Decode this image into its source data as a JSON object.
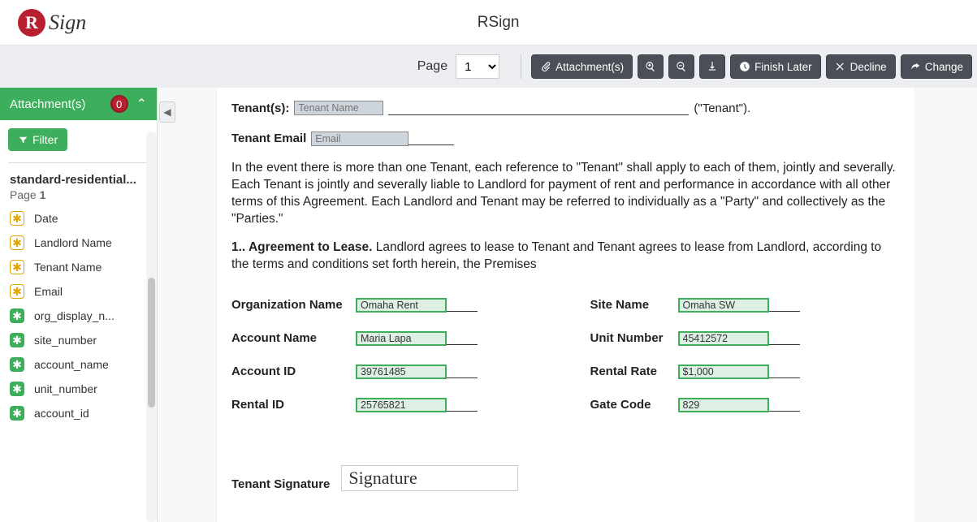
{
  "app": {
    "brand_letter": "R",
    "brand_word": "Sign",
    "title": "RSign"
  },
  "toolbar": {
    "page_label": "Page",
    "page_value": "1",
    "attachments": "Attachment(s)",
    "finish_later": "Finish Later",
    "decline": "Decline",
    "change": "Change"
  },
  "sidebar": {
    "header": "Attachment(s)",
    "badge": "0",
    "filter": "Filter",
    "document": "standard-residential...",
    "page_label": "Page",
    "page_num": "1",
    "fields": [
      {
        "icon": "req",
        "label": "Date"
      },
      {
        "icon": "req",
        "label": "Landlord Name"
      },
      {
        "icon": "req",
        "label": "Tenant Name"
      },
      {
        "icon": "req",
        "label": "Email"
      },
      {
        "icon": "merge",
        "label": "org_display_n..."
      },
      {
        "icon": "merge",
        "label": "site_number"
      },
      {
        "icon": "merge",
        "label": "account_name"
      },
      {
        "icon": "merge",
        "label": "unit_number"
      },
      {
        "icon": "merge",
        "label": "account_id"
      }
    ]
  },
  "doc": {
    "tenant_label": "Tenant(s):",
    "tenant_placeholder": "Tenant Name",
    "tenant_suffix": "(\"Tenant\").",
    "tenant_email_label": "Tenant Email",
    "tenant_email_placeholder": "Email",
    "para1": "In the event there is more than one Tenant, each reference to \"Tenant\" shall apply to each of them, jointly and severally. Each Tenant is jointly and severally liable to Landlord for payment of rent and performance in accordance with all other terms of this Agreement. Each Landlord and Tenant may be referred to individually as a \"Party\" and collectively as the \"Parties.\"",
    "para2_lead": "1.. Agreement to Lease.",
    "para2_rest": " Landlord agrees to lease to Tenant and Tenant agrees to lease from Landlord, according to the terms and conditions set forth herein, the Premises",
    "merge": {
      "org_label": "Organization Name",
      "org_value": "Omaha Rent",
      "site_label": "Site Name",
      "site_value": "Omaha SW",
      "acct_name_label": "Account Name",
      "acct_name_value": "Maria Lapa",
      "unit_label": "Unit Number",
      "unit_value": "45412572",
      "acct_id_label": "Account ID",
      "acct_id_value": "39761485",
      "rate_label": "Rental Rate",
      "rate_value": "$1,000",
      "rental_id_label": "Rental ID",
      "rental_id_value": "25765821",
      "gate_label": "Gate Code",
      "gate_value": "829"
    },
    "sig_label": "Tenant Signature",
    "sig_placeholder": "Signature"
  }
}
